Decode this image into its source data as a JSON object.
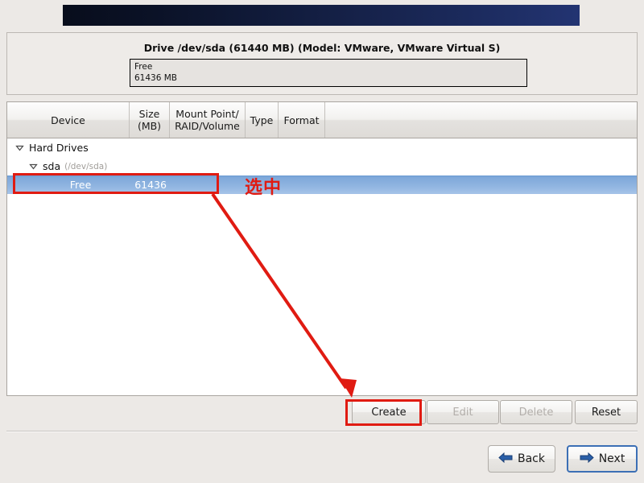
{
  "banner": {
    "name": "installer-header-banner"
  },
  "drive_panel": {
    "title": "Drive /dev/sda (61440 MB) (Model: VMware, VMware Virtual S)",
    "bar_label": "Free\n61436 MB"
  },
  "table": {
    "headers": {
      "device": "Device",
      "size_line1": "Size",
      "size_line2": "(MB)",
      "mount_line1": "Mount Point/",
      "mount_line2": "RAID/Volume",
      "type": "Type",
      "format": "Format"
    },
    "rows": [
      {
        "name": "Hard Drives",
        "sub": "",
        "size": "",
        "indent": 0,
        "expander": "down",
        "selected": false
      },
      {
        "name": "sda",
        "sub": "(/dev/sda)",
        "size": "",
        "indent": 1,
        "expander": "down",
        "selected": false
      },
      {
        "name": "Free",
        "sub": "",
        "size": "61436",
        "indent": 2,
        "expander": "none",
        "selected": true
      }
    ]
  },
  "buttons": {
    "create": "Create",
    "edit": "Edit",
    "delete": "Delete",
    "reset": "Reset"
  },
  "navigation": {
    "back": "Back",
    "next": "Next"
  },
  "annotations": {
    "selected_note": "选中",
    "highlight_color": "#e01b12"
  },
  "icons": {
    "expander": "triangle-down-icon",
    "back": "arrow-left-icon",
    "next": "arrow-right-icon"
  }
}
